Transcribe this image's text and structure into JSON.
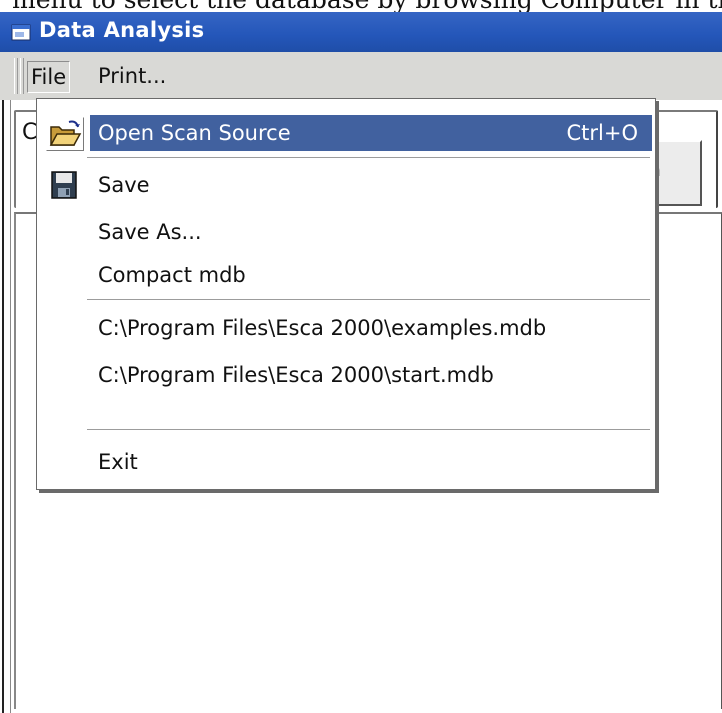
{
  "caption": {
    "text": "menu to select the database by browsing Computer in the"
  },
  "window": {
    "title": "Data Analysis",
    "title_icon": "window-app-icon"
  },
  "menubar": {
    "file_label": "File",
    "print_label": "Print..."
  },
  "background": {
    "group_text": "C",
    "button_glyph": "a"
  },
  "file_menu": {
    "open_label": "Open Scan Source",
    "open_accel": "Ctrl+O",
    "open_icon": "open-folder-icon",
    "save_label": "Save",
    "save_icon": "floppy-disk-icon",
    "save_as_label": "Save As...",
    "compact_label": "Compact mdb",
    "recent_files": [
      "C:\\Program Files\\Esca 2000\\examples.mdb",
      "C:\\Program Files\\Esca 2000\\start.mdb"
    ],
    "exit_label": "Exit"
  },
  "colors": {
    "titlebar": "#2456b9",
    "highlight": "#41619f",
    "menu_bg": "#d9d9d6"
  }
}
